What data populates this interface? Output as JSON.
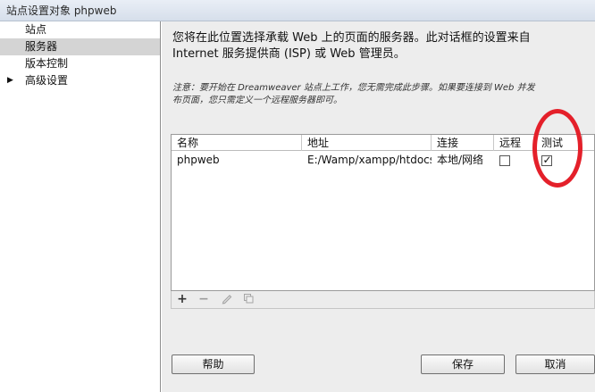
{
  "window": {
    "title": "站点设置对象 phpweb"
  },
  "sidebar": {
    "items": [
      {
        "label": "站点",
        "selected": false
      },
      {
        "label": "服务器",
        "selected": true
      },
      {
        "label": "版本控制",
        "selected": false
      },
      {
        "label": "高级设置",
        "selected": false,
        "expandable": true
      }
    ]
  },
  "main": {
    "description_line1": "您将在此位置选择承载 Web 上的页面的服务器。此对话框的设置来自",
    "description_line2": "Internet 服务提供商 (ISP) 或 Web 管理员。",
    "note_line1": "注意：要开始在 Dreamweaver 站点上工作，您无需完成此步骤。如果要连接到 Web 并发",
    "note_line2": "布页面，您只需定义一个远程服务器即可。",
    "table": {
      "columns": [
        "名称",
        "地址",
        "连接",
        "远程",
        "测试"
      ],
      "rows": [
        {
          "name": "phpweb",
          "address": "E:/Wamp/xampp/htdocs/...",
          "connection": "本地/网络",
          "remote": false,
          "test": true
        }
      ]
    },
    "toolbar": {
      "add_icon": "plus-icon",
      "remove_icon": "minus-icon",
      "edit_icon": "pencil-icon",
      "duplicate_icon": "duplicate-icon"
    }
  },
  "buttons": {
    "help_label": "帮助",
    "save_label": "保存",
    "cancel_label": "取消"
  },
  "colors": {
    "highlight": "#e4202a",
    "selected_item_bg": "#d4d4d4",
    "panel_bg": "#ededed"
  }
}
